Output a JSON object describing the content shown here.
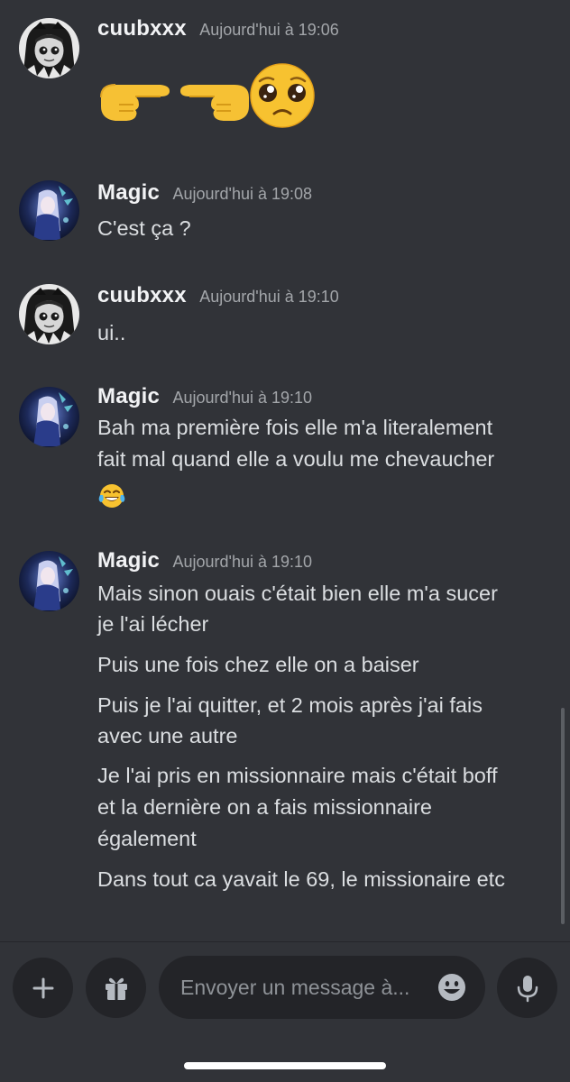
{
  "messages": [
    {
      "author": "cuubxxx",
      "time": "Aujourd'hui à 19:06",
      "lines": [],
      "emoji": [
        "pointing-right-hand",
        "pointing-left-hand",
        "pleading-face"
      ]
    },
    {
      "author": "Magic",
      "time": "Aujourd'hui à 19:08",
      "lines": [
        "C'est ça ?"
      ]
    },
    {
      "author": "cuubxxx",
      "time": "Aujourd'hui à 19:10",
      "lines": [
        "ui.."
      ]
    },
    {
      "author": "Magic",
      "time": "Aujourd'hui à 19:10",
      "lines": [
        "Bah ma première fois elle m'a literalement",
        "fait mal quand elle a voulu me chevaucher"
      ],
      "emoji": [
        "tears-of-joy-face"
      ]
    },
    {
      "author": "Magic",
      "time": "Aujourd'hui à 19:10",
      "lines": [
        "Mais sinon ouais c'était bien elle m'a sucer",
        "je l'ai lécher",
        "Puis une fois chez elle on a baiser",
        "Puis je l'ai quitter, et 2 mois après j'ai fais",
        "avec une autre",
        "Je l'ai pris en missionnaire mais c'était boff",
        "et la dernière on a fais missionnaire",
        "également",
        "Dans tout ca yavait le 69, le missionaire etc"
      ]
    }
  ],
  "composer": {
    "placeholder": "Envoyer un message à...",
    "add_icon": "plus-icon",
    "gift_icon": "gift-icon",
    "emoji_icon": "emoji-smile-icon",
    "mic_icon": "microphone-icon"
  },
  "colors": {
    "background": "#313338",
    "input_background": "#232428",
    "username": "#f2f3f5",
    "timestamp": "#a3a6aa",
    "message_text": "#dbdee1"
  }
}
